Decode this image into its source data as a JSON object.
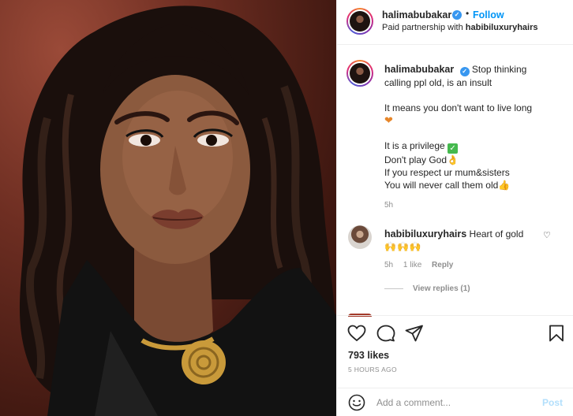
{
  "header": {
    "username": "halimabubakar",
    "verified_mark": "✓",
    "dot": "•",
    "follow_label": "Follow",
    "paid_prefix": "Paid partnership with",
    "partner": "habibiluxuryhairs"
  },
  "caption": {
    "username": "halimabubakar",
    "verified_mark": "✓",
    "line1": "Stop thinking",
    "line2": "calling ppl old, is an insult",
    "line3": "It means you don't want to live long",
    "heart": "❤",
    "line4": "It is a privilege",
    "check": "✓",
    "line5": "Don't play God",
    "hand1": "👌",
    "line6": "If you respect ur mum&sisters",
    "line7": "You will never call them old",
    "hand2": "👍",
    "time": "5h"
  },
  "comment": {
    "username": "habibiluxuryhairs",
    "text": "Heart of gold",
    "emoji": "🙌🙌🙌",
    "heart_icon": "♡",
    "time": "5h",
    "likes": "1 like",
    "reply_label": "Reply",
    "view_replies": "View replies (1)"
  },
  "actions": {
    "icons": [
      "heart-outline-icon",
      "comment-icon",
      "share-icon",
      "bookmark-icon"
    ],
    "likes": "793 likes",
    "time_ago": "5 HOURS AGO"
  },
  "add_comment": {
    "placeholder": "Add a comment...",
    "post_label": "Post",
    "smile_icon": "smile-icon"
  },
  "colors": {
    "link_blue": "#0095f6",
    "verified_blue": "#3897f0",
    "post_disabled": "#b2dffc",
    "muted": "#8e8e8e",
    "text": "#262626"
  }
}
